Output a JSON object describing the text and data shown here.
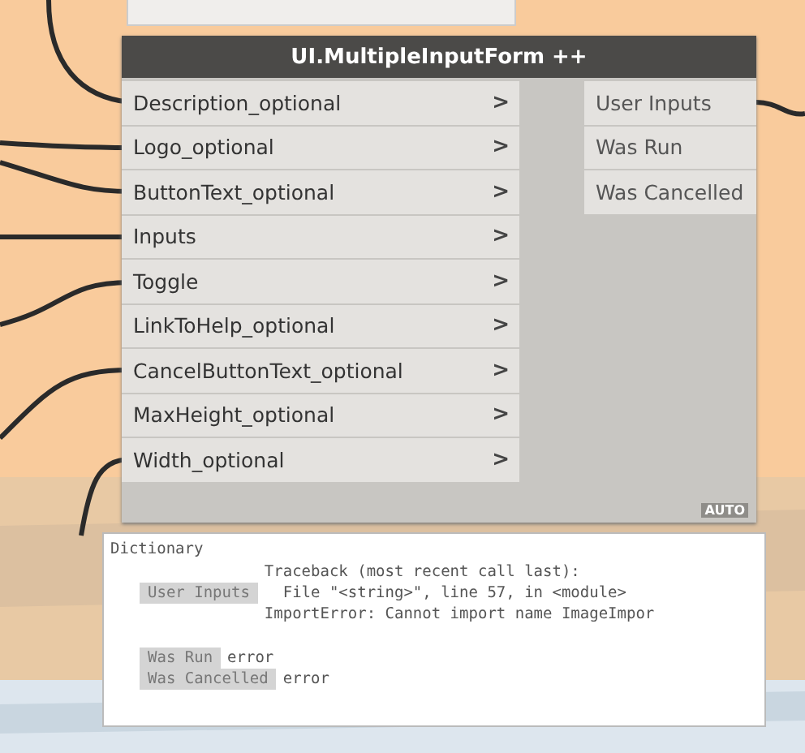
{
  "node": {
    "title": "UI.MultipleInputForm ++",
    "inputs": [
      {
        "name": "Description_optional"
      },
      {
        "name": "Logo_optional"
      },
      {
        "name": "ButtonText_optional"
      },
      {
        "name": "Inputs"
      },
      {
        "name": "Toggle"
      },
      {
        "name": "LinkToHelp_optional"
      },
      {
        "name": "CancelButtonText_optional"
      },
      {
        "name": "MaxHeight_optional"
      },
      {
        "name": "Width_optional"
      }
    ],
    "arrow": ">",
    "outputs": [
      "User Inputs",
      "Was Run",
      "Was Cancelled"
    ],
    "lacing": "AUTO"
  },
  "watch": {
    "type": "Dictionary",
    "entries": [
      {
        "key": "User Inputs",
        "lines": [
          "Traceback (most recent call last):",
          "  File \"<string>\", line 57, in <module>",
          "ImportError: Cannot import name ImageImpor"
        ]
      },
      {
        "key": "Was Run",
        "lines": [
          "error"
        ]
      },
      {
        "key": "Was Cancelled",
        "lines": [
          "error"
        ]
      }
    ]
  }
}
